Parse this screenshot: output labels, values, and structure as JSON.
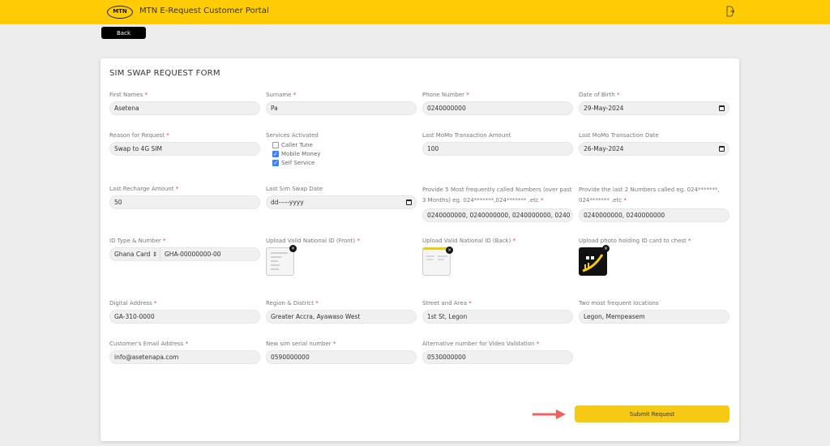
{
  "header": {
    "logo_text": "MTN",
    "title": "MTN E-Request Customer Portal",
    "logout_icon": "logout-icon"
  },
  "back_label": "Back",
  "form": {
    "title": "SIM SWAP REQUEST FORM",
    "first_names": {
      "label": "First Names",
      "value": "Asetena"
    },
    "surname": {
      "label": "Surname",
      "value": "Pa"
    },
    "phone": {
      "label": "Phone Number",
      "value": "0240000000"
    },
    "dob": {
      "label": "Date of Birth",
      "value": "29-May-2024"
    },
    "reason": {
      "label": "Reason for Request",
      "value": "Swap to 4G SIM"
    },
    "services": {
      "label": "Services Activated",
      "options": [
        {
          "label": "Caller Tune",
          "checked": false
        },
        {
          "label": "Mobile Money",
          "checked": true
        },
        {
          "label": "Self Service",
          "checked": true
        }
      ]
    },
    "momo_amount": {
      "label": "Last MoMo Transaction Amount",
      "value": "100"
    },
    "momo_date": {
      "label": "Last MoMo Transaction Date",
      "value": "26-May-2024"
    },
    "recharge": {
      "label": "Last Recharge Amount",
      "value": "50"
    },
    "swap_date": {
      "label": "Last Sim Swap Date",
      "value": "dd-----yyyy"
    },
    "five_numbers": {
      "label": "Provide 5 Most frequently called Numbers (over past 3 Months) eg. 024*******,024******* .etc",
      "value": "0240000000, 0240000000, 0240000000, 0240"
    },
    "two_numbers": {
      "label": "Provide the last 2 Numbers called eg. 024*******, 024******* .etc",
      "value": "0240000000, 0240000000"
    },
    "id_type": {
      "label": "ID Type & Number",
      "type": "Ghana Card",
      "number": "GHA-00000000-00"
    },
    "id_front": {
      "label": "Upload Valid National ID (Front)"
    },
    "id_back": {
      "label": "Upload Valid National ID (Back)"
    },
    "photo": {
      "label": "Upload photo holding ID card to chest"
    },
    "digital_address": {
      "label": "Digital Address",
      "value": "GA-310-0000"
    },
    "region": {
      "label": "Region & District",
      "value": "Greater Accra, Ayawaso West"
    },
    "street": {
      "label": "Street and Area",
      "value": "1st St, Legon"
    },
    "locations": {
      "label": "Two most frequent locations",
      "value": "Legon, Mempeasem"
    },
    "email": {
      "label": "Customer's Email Address",
      "value": "info@asetenapa.com"
    },
    "sim_serial": {
      "label": "New sim serial number",
      "value": "0590000000"
    },
    "alt_number": {
      "label": "Alternative number for Video Validation",
      "value": "0530000000"
    },
    "submit_label": "Submit Request",
    "required_mark": "*",
    "remove_mark": "×"
  },
  "colors": {
    "brand": "#ffcb05",
    "submit": "#f6c915",
    "required": "#e53935",
    "annotation_arrow": "#f06060"
  }
}
